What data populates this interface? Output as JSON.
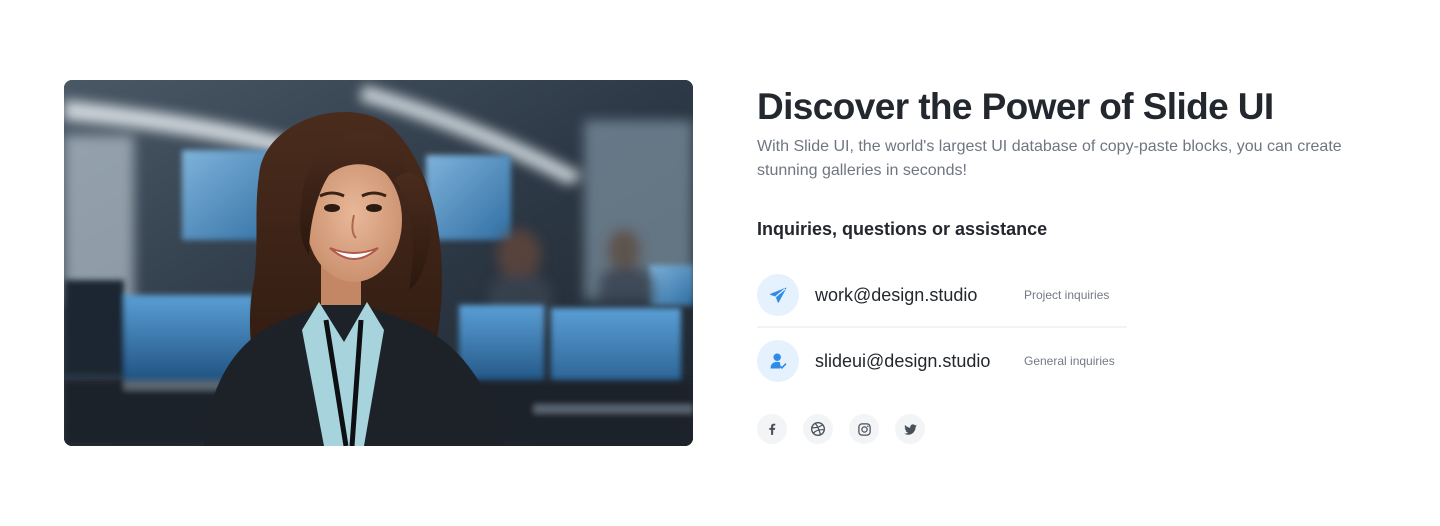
{
  "hero": {
    "image_alt": "Smiling woman in a dark blazer standing in an office with monitors"
  },
  "main": {
    "title": "Discover the Power of Slide UI",
    "description": "With Slide UI, the world's largest UI database of copy-paste blocks, you can create stunning galleries in seconds!",
    "subheading": "Inquiries, questions or assistance"
  },
  "contacts": [
    {
      "email": "work@design.studio",
      "note": "Project inquiries",
      "icon": "paper-plane-icon"
    },
    {
      "email": "slideui@design.studio",
      "note": "General inquiries",
      "icon": "user-check-icon"
    }
  ],
  "socials": [
    {
      "icon": "facebook-icon"
    },
    {
      "icon": "dribbble-icon"
    },
    {
      "icon": "instagram-icon"
    },
    {
      "icon": "twitter-icon"
    }
  ],
  "colors": {
    "accent": "#2e8bea",
    "icon_bg": "#e5f1fd",
    "heading": "#23272e",
    "muted": "#6f7682",
    "social_bg": "#f3f4f6"
  }
}
